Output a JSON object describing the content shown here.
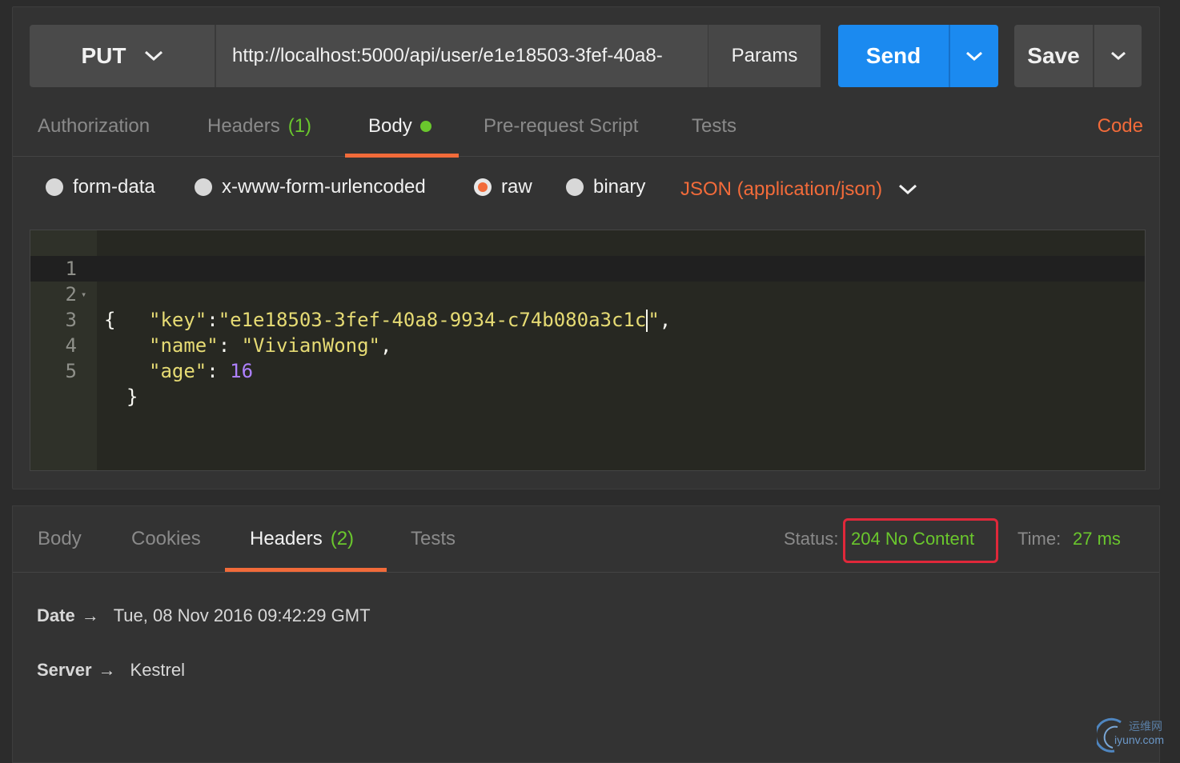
{
  "request": {
    "method": "PUT",
    "url": "http://localhost:5000/api/user/e1e18503-3fef-40a8-",
    "params_label": "Params",
    "send_label": "Send",
    "save_label": "Save"
  },
  "request_tabs": {
    "authorization": "Authorization",
    "headers": "Headers",
    "headers_count": "(1)",
    "body": "Body",
    "prerequest": "Pre-request Script",
    "tests": "Tests",
    "code": "Code"
  },
  "body_types": {
    "form_data": "form-data",
    "urlencoded": "x-www-form-urlencoded",
    "raw": "raw",
    "binary": "binary",
    "content_type": "JSON (application/json)",
    "selected": "raw"
  },
  "editor": {
    "line_numbers": [
      "1",
      "2",
      "3",
      "4",
      "5"
    ],
    "lines": {
      "l1": "{",
      "key_name": "\"key\"",
      "key_sep": ":",
      "key_value": "\"e1e18503-3fef-40a8-9934-c74b080a3c1c",
      "key_value_end": "\"",
      "key_comma": ",",
      "name_name": "\"name\"",
      "name_sep": ": ",
      "name_value": "\"VivianWong\"",
      "name_comma": ",",
      "age_name": "\"age\"",
      "age_sep": ": ",
      "age_value": "16",
      "l5": "}"
    }
  },
  "response_tabs": {
    "body": "Body",
    "cookies": "Cookies",
    "headers": "Headers",
    "headers_count": "(2)",
    "tests": "Tests"
  },
  "response_status": {
    "status_label": "Status:",
    "status_value": "204 No Content",
    "time_label": "Time:",
    "time_value": "27 ms"
  },
  "response_headers": [
    {
      "key": "Date",
      "value": "Tue, 08 Nov 2016 09:42:29 GMT"
    },
    {
      "key": "Server",
      "value": "Kestrel"
    }
  ],
  "watermark": {
    "line1": "运维网",
    "line2": "iyunv.com"
  },
  "colors": {
    "accent": "#f26b3a",
    "send": "#1b8af0",
    "success": "#6ac72d",
    "highlight_box": "#e0283a"
  }
}
